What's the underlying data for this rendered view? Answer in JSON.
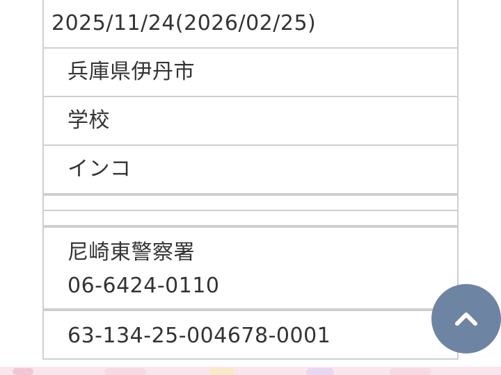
{
  "rows": {
    "date_range": "2025/11/24(2026/02/25)",
    "location": "兵庫県伊丹市",
    "place": "学校",
    "animal": "インコ",
    "empty_1": "",
    "empty_2": "",
    "police_station": "尼崎東警察署",
    "police_phone": "06-6424-0110",
    "receipt_number": "63-134-25-004678-0001"
  },
  "scroll_top_button": {
    "icon": "chevron-up-icon",
    "color": "#6e84a3"
  },
  "colors": {
    "border": "#cfcfcf",
    "text": "#333333",
    "footer_strip": "#fbe6ee"
  }
}
